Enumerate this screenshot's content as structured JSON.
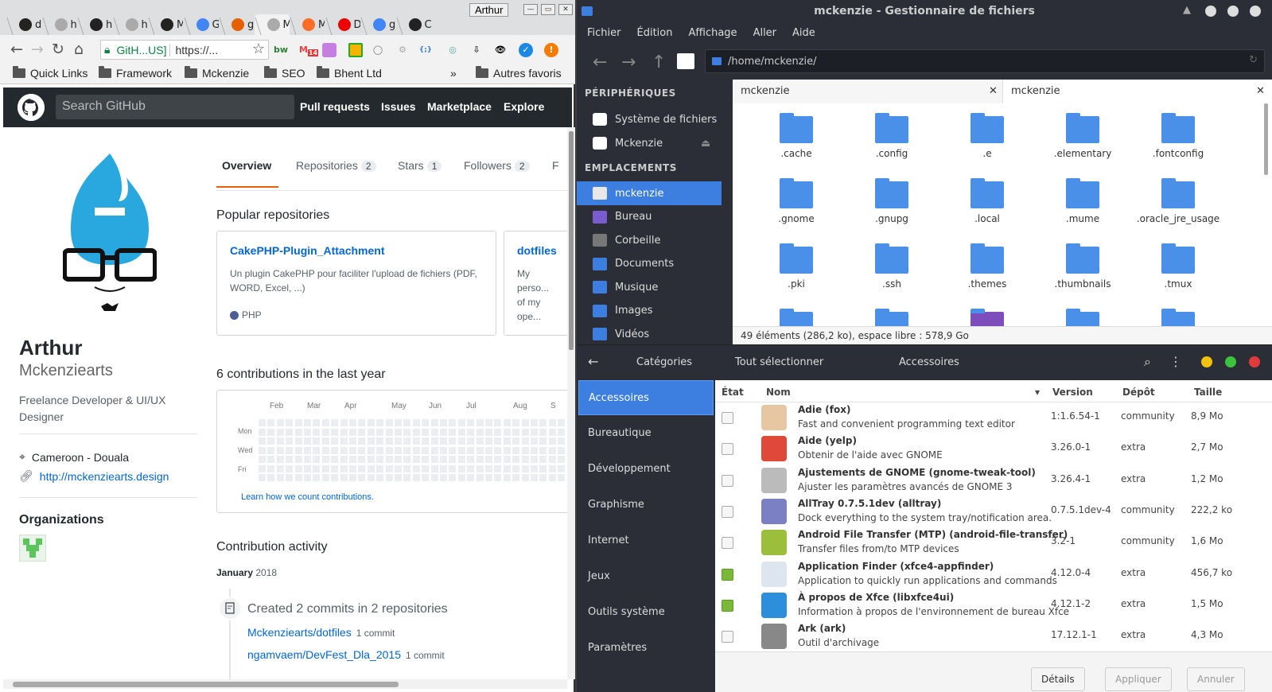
{
  "chrome": {
    "tabs": [
      {
        "label": "d",
        "icon": "github-icon"
      },
      {
        "label": "h",
        "icon": "page-icon"
      },
      {
        "label": "h",
        "icon": "github-icon"
      },
      {
        "label": "h",
        "icon": "page-icon"
      },
      {
        "label": "M",
        "icon": "github-icon"
      },
      {
        "label": "G",
        "icon": "translate-icon"
      },
      {
        "label": "g",
        "icon": "firefox-icon"
      },
      {
        "label": "M",
        "icon": "page-icon"
      },
      {
        "label": "M",
        "icon": "gitlab-icon"
      },
      {
        "label": "D",
        "icon": "youtube-icon"
      },
      {
        "label": "g",
        "icon": "google-icon"
      },
      {
        "label": "C",
        "icon": "github-icon"
      }
    ],
    "profile_name": "Arthur",
    "secure_label": "GitH...US]",
    "url": "https://...",
    "ext_badge": "14",
    "bookmarks": [
      "Quick Links",
      "Framework",
      "Mckenzie",
      "SEO",
      "Bhent Ltd"
    ],
    "bookmarks_overflow": "»",
    "other_bookmarks": "Autres favoris"
  },
  "github": {
    "search_placeholder": "Search GitHub",
    "nav": [
      "Pull requests",
      "Issues",
      "Marketplace",
      "Explore"
    ],
    "profile": {
      "name": "Arthur",
      "username": "Mckenziearts",
      "bio": "Freelance Developer & UI/UX Designer",
      "location": "Cameroon - Douala",
      "website": "http://mckenziearts.design",
      "organizations_heading": "Organizations"
    },
    "tabs": [
      {
        "label": "Overview",
        "count": null
      },
      {
        "label": "Repositories",
        "count": "2"
      },
      {
        "label": "Stars",
        "count": "1"
      },
      {
        "label": "Followers",
        "count": "2"
      },
      {
        "label": "F",
        "count": null
      }
    ],
    "popular_heading": "Popular repositories",
    "repos": [
      {
        "title": "CakePHP-Plugin_Attachment",
        "desc": "Un plugin CakePHP pour faciliter l'upload de fichiers (PDF, WORD, Excel, ...)",
        "lang": "PHP",
        "lang_color": "#4F5D95"
      },
      {
        "title": "dotfiles",
        "desc": "My perso... of my ope...",
        "lang": "",
        "lang_color": ""
      }
    ],
    "contributions_heading": "6 contributions in the last year",
    "months": [
      "Feb",
      "Mar",
      "Apr",
      "May",
      "Jun",
      "Jul",
      "Aug",
      "S"
    ],
    "days": [
      "Mon",
      "Wed",
      "Fri"
    ],
    "learn_link": "Learn how we count contributions.",
    "activity_heading": "Contribution activity",
    "activity_month": "January",
    "activity_year": "2018",
    "activity_summary": "Created 2 commits in 2 repositories",
    "activity_repos": [
      {
        "name": "Mckenziearts/dotfiles",
        "count": "1 commit"
      },
      {
        "name": "ngamvaem/DevFest_Dla_2015",
        "count": "1 commit"
      }
    ]
  },
  "files": {
    "title": "mckenzie - Gestionnaire de fichiers",
    "menu": [
      "Fichier",
      "Édition",
      "Affichage",
      "Aller",
      "Aide"
    ],
    "location": "/home/mckenzie/",
    "side_devices_heading": "PÉRIPHÉRIQUES",
    "devices": [
      "Système de fichiers",
      "Mckenzie"
    ],
    "side_places_heading": "EMPLACEMENTS",
    "places": [
      {
        "label": "mckenzie",
        "color": "#e8e8e8"
      },
      {
        "label": "Bureau",
        "color": "#7b5ccf"
      },
      {
        "label": "Corbeille",
        "color": "#777"
      },
      {
        "label": "Documents",
        "color": "#3d7fe0"
      },
      {
        "label": "Musique",
        "color": "#3d7fe0"
      },
      {
        "label": "Images",
        "color": "#3d7fe0"
      },
      {
        "label": "Vidéos",
        "color": "#3d7fe0"
      }
    ],
    "tabs": [
      "mckenzie",
      "mckenzie"
    ],
    "items": [
      ".cache",
      ".config",
      ".e",
      ".elementary",
      ".fontconfig",
      ".gnome",
      ".gnupg",
      ".local",
      ".mume",
      ".oracle_jre_usage",
      ".pki",
      ".ssh",
      ".themes",
      ".thumbnails",
      ".tmux"
    ],
    "status": "49 éléments (286,2 ko), espace libre : 578,9 Go"
  },
  "pamac": {
    "header": {
      "categories": "Catégories",
      "select_all": "Tout sélectionner",
      "title": "Accessoires"
    },
    "categories": [
      "Accessoires",
      "Bureautique",
      "Développement",
      "Graphisme",
      "Internet",
      "Jeux",
      "Outils système",
      "Paramètres"
    ],
    "columns": {
      "state": "État",
      "name": "Nom",
      "version": "Version",
      "repo": "Dépôt",
      "size": "Taille"
    },
    "packages": [
      {
        "name": "Adie  (fox)",
        "desc": "Fast and convenient programming text editor",
        "version": "1:1.6.54-1",
        "repo": "community",
        "size": "8,9 Mo",
        "installed": false,
        "icon": "adie-icon",
        "color": "#e7c6a4"
      },
      {
        "name": "Aide  (yelp)",
        "desc": "Obtenir de l'aide avec GNOME",
        "version": "3.26.0-1",
        "repo": "extra",
        "size": "2,7 Mo",
        "installed": false,
        "icon": "lifebuoy-icon",
        "color": "#e0483a"
      },
      {
        "name": "Ajustements de GNOME  (gnome-tweak-tool)",
        "desc": "Ajuster les paramètres avancés de GNOME 3",
        "version": "3.26.4-1",
        "repo": "extra",
        "size": "1,2 Mo",
        "installed": false,
        "icon": "tweak-icon",
        "color": "#bbbbbb"
      },
      {
        "name": "AllTray 0.7.5.1dev  (alltray)",
        "desc": "Dock everything to the system tray/notification area.",
        "version": "0.7.5.1dev-4",
        "repo": "community",
        "size": "222,2 ko",
        "installed": false,
        "icon": "alltray-icon",
        "color": "#7b7fc4"
      },
      {
        "name": "Android File Transfer (MTP)  (android-file-transfer)",
        "desc": "Transfer files from/to MTP devices",
        "version": "3.2-1",
        "repo": "community",
        "size": "1,6 Mo",
        "installed": false,
        "icon": "aft-icon",
        "color": "#9bbf3b"
      },
      {
        "name": "Application Finder  (xfce4-appfinder)",
        "desc": "Application to quickly run applications and commands",
        "version": "4.12.0-4",
        "repo": "extra",
        "size": "456,7 ko",
        "installed": true,
        "icon": "magnifier-icon",
        "color": "#dde6f0"
      },
      {
        "name": "À propos de Xfce  (libxfce4ui)",
        "desc": "Information à propos de l'environnement de bureau Xfce",
        "version": "4.12.1-2",
        "repo": "extra",
        "size": "1,5 Mo",
        "installed": true,
        "icon": "info-icon",
        "color": "#2d8fdc"
      },
      {
        "name": "Ark  (ark)",
        "desc": "Outil d'archivage",
        "version": "17.12.1-1",
        "repo": "extra",
        "size": "4,3 Mo",
        "installed": false,
        "icon": "ark-icon",
        "color": "#888888"
      }
    ],
    "buttons": [
      "Détails",
      "Appliquer",
      "Annuler"
    ]
  }
}
